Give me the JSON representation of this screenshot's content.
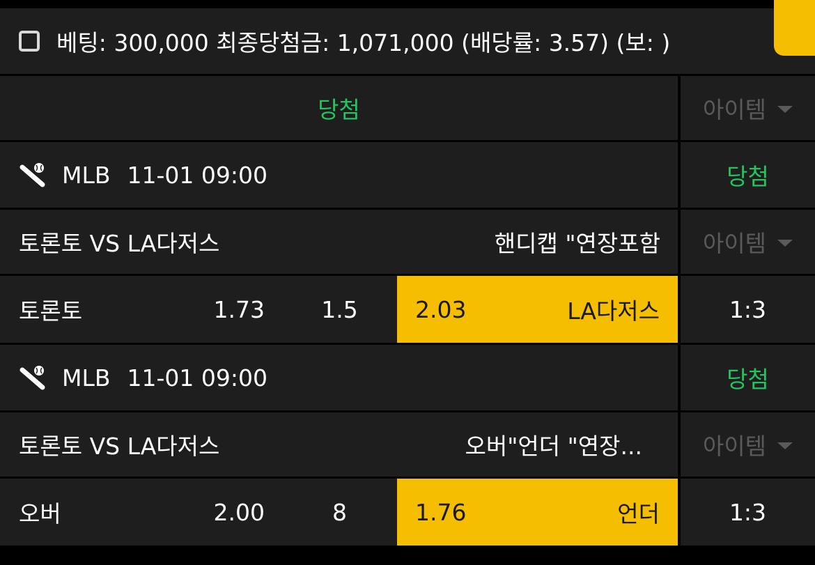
{
  "header": {
    "summary": "베팅: 300,000 최종당첨금: 1,071,000 (배당률: 3.57) (보: )"
  },
  "overall": {
    "result": "당첨",
    "item_label": "아이템"
  },
  "games": [
    {
      "league": "MLB",
      "datetime": "11-01 09:00",
      "result": "당첨",
      "matchup": "토론토 VS LA다저스",
      "bet_type": "핸디캡 \"연장포함",
      "item_label": "아이템",
      "home_label": "토론토",
      "home_odds": "1.73",
      "line": "1.5",
      "away_odds": "2.03",
      "away_label": "LA다저스",
      "score": "1:3",
      "selected": "away"
    },
    {
      "league": "MLB",
      "datetime": "11-01 09:00",
      "result": "당첨",
      "matchup": "토론토 VS LA다저스",
      "bet_type": "오버\"언더 \"연장...",
      "item_label": "아이템",
      "home_label": "오버",
      "home_odds": "2.00",
      "line": "8",
      "away_odds": "1.76",
      "away_label": "언더",
      "score": "1:3",
      "selected": "away"
    }
  ],
  "colors": {
    "accent": "#f6be00",
    "win": "#22c55e",
    "panel": "#1e1e1e",
    "muted": "#5a5a5a"
  }
}
